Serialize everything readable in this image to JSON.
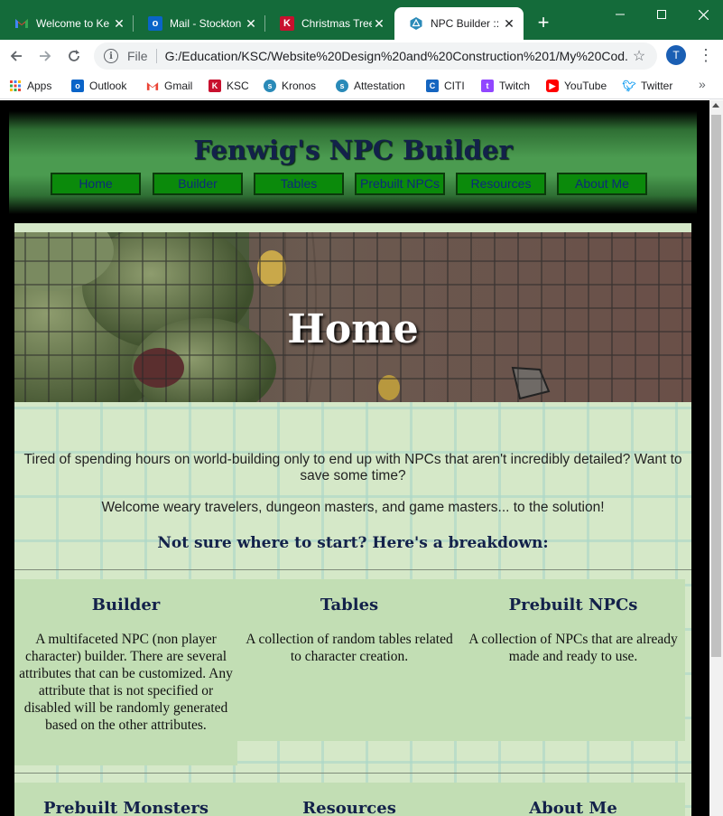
{
  "browser": {
    "tabs": [
      {
        "title": "Welcome to Ke",
        "icon": "gmail-icon",
        "active": false
      },
      {
        "title": "Mail - Stockton",
        "icon": "outlook-icon",
        "active": false
      },
      {
        "title": "Christmas Tree",
        "icon": "k-icon",
        "active": false
      },
      {
        "title": "NPC Builder :: F",
        "icon": "npc-icon",
        "active": true
      }
    ],
    "close_glyph": "✕",
    "new_tab_glyph": "+",
    "scheme": "File",
    "url": "G:/Education/KSC/Website%20Design%20and%20Construction%201/My%20Cod...",
    "profile_initial": "T",
    "bookmarks": [
      {
        "label": "Apps",
        "icon": "apps-grid-icon"
      },
      {
        "label": "Outlook",
        "icon": "outlook-icon"
      },
      {
        "label": "Gmail",
        "icon": "gmail-icon"
      },
      {
        "label": "KSC",
        "icon": "k-icon"
      },
      {
        "label": "Kronos",
        "icon": "kronos-icon"
      },
      {
        "label": "Attestation",
        "icon": "kronos-icon"
      },
      {
        "label": "CITI",
        "icon": "citi-icon"
      },
      {
        "label": "Twitch",
        "icon": "twitch-icon"
      },
      {
        "label": "YouTube",
        "icon": "youtube-icon"
      },
      {
        "label": "Twitter",
        "icon": "twitter-icon"
      }
    ],
    "overflow_glyph": "»"
  },
  "site": {
    "title": "Fenwig's NPC Builder",
    "nav": [
      "Home",
      "Builder",
      "Tables",
      "Prebuilt NPCs",
      "Resources",
      "About Me"
    ],
    "hero_title": "Home",
    "intro_1": "Tired of spending hours on world-building only to end up with NPCs that aren't incredibly detailed? Want to save some time?",
    "intro_2": "Welcome weary travelers, dungeon masters, and game masters... to the solution!",
    "breakdown_heading": "Not sure where to start? Here's a breakdown:",
    "cards": [
      {
        "title": "Builder",
        "body": "A multifaceted NPC (non player character) builder. There are several attributes that can be customized. Any attribute that is not specified or disabled will be randomly generated based on the other attributes."
      },
      {
        "title": "Tables",
        "body": "A collection of random tables related to character creation."
      },
      {
        "title": "Prebuilt NPCs",
        "body": "A collection of NPCs that are already made and ready to use."
      },
      {
        "title": "Prebuilt Monsters",
        "body": ""
      },
      {
        "title": "Resources",
        "body": ""
      },
      {
        "title": "About Me",
        "body": ""
      }
    ]
  },
  "colors": {
    "brick_background": "#ff0000",
    "header_green": "#4b9b50",
    "nav_button": "#0b8a0b",
    "content_bg": "#d5e8c8",
    "card_bg": "#c2deb4",
    "title_navy": "#13214a"
  }
}
